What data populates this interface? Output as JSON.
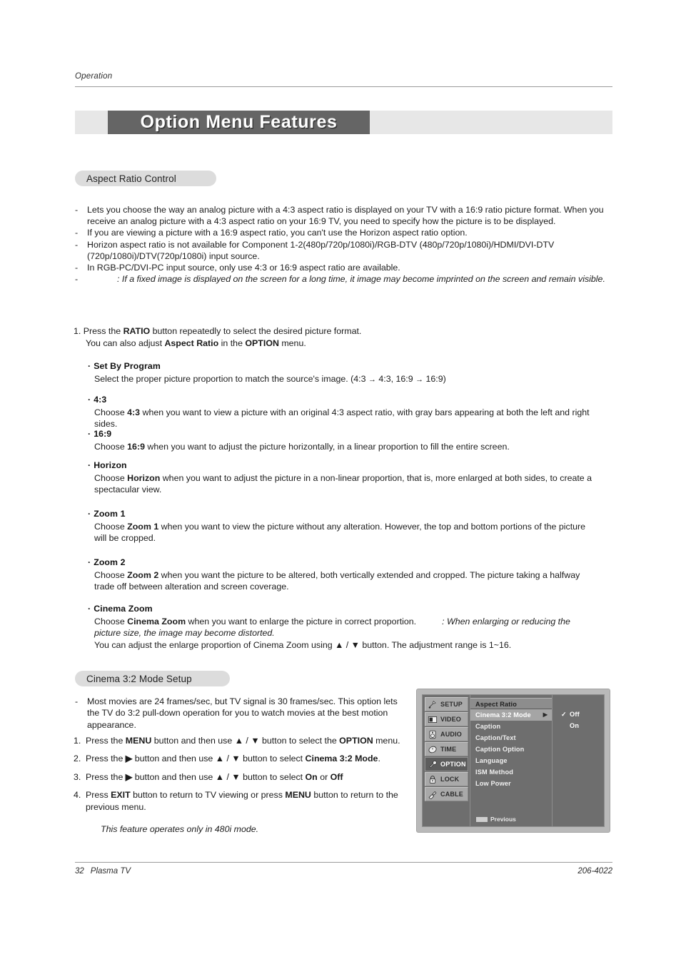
{
  "header": {
    "running_head": "Operation",
    "banner_title": "Option Menu Features"
  },
  "sections": {
    "aspect_pill": "Aspect Ratio Control",
    "cinema_pill": "Cinema 3:2 Mode Setup"
  },
  "aspect_bullets": [
    {
      "marker": "-",
      "text": "Lets you choose the way an analog picture with a 4:3 aspect ratio is displayed on your TV with a 16:9 ratio picture format. When you receive an analog picture with a 4:3 aspect ratio on your 16:9 TV, you need to specify how the picture is to be displayed."
    },
    {
      "marker": "-",
      "text": "If you are viewing a picture with a 16:9 aspect ratio, you can't use the Horizon aspect ratio option."
    },
    {
      "marker": "-",
      "text": "Horizon aspect ratio is not available for Component 1-2(480p/720p/1080i)/RGB-DTV (480p/720p/1080i)/HDMI/DVI-DTV (720p/1080i)/DTV(720p/1080i) input source."
    },
    {
      "marker": "-",
      "text": "In RGB-PC/DVI-PC input source, only use 4:3 or 16:9 aspect ratio are available."
    },
    {
      "marker": "-",
      "text": ": If a fixed image is displayed on the screen for a long time, it image may become imprinted on the screen and remain visible."
    }
  ],
  "step_one": {
    "line1_a": "1. Press the ",
    "line1_b": "RATIO",
    "line1_c": " button repeatedly to select the desired picture format.",
    "line2_a": "You can also adjust ",
    "line2_b": "Aspect Ratio",
    "line2_c": " in the ",
    "line2_d": "OPTION",
    "line2_e": " menu."
  },
  "options": [
    {
      "heading": "Set By Program",
      "body_pre": "Select the proper picture proportion to match the source's image.  (4:3 ",
      "body_arrow1": "→",
      "body_mid": " 4:3, 16:9 ",
      "body_arrow2": "→",
      "body_post": " 16:9)"
    },
    {
      "heading": "4:3",
      "body_pre": "Choose ",
      "body_bold": "4:3",
      "body_post": " when you want to view a picture with an original 4:3 aspect ratio, with gray bars appearing at both the left and right sides."
    },
    {
      "heading": "16:9",
      "body_pre": "Choose ",
      "body_bold": "16:9",
      "body_post": " when you want to adjust the picture horizontally, in a linear proportion to fill the entire screen."
    },
    {
      "heading": "Horizon",
      "body_pre": "Choose ",
      "body_bold": "Horizon",
      "body_post": " when you want to adjust the picture in a non-linear proportion, that is, more enlarged at both sides, to create a spectacular view."
    },
    {
      "heading": "Zoom 1",
      "body_pre": "Choose ",
      "body_bold": "Zoom 1",
      "body_post": " when you want to view the picture without any alteration. However, the top and bottom portions of the picture will be cropped."
    },
    {
      "heading": "Zoom 2",
      "body_pre": "Choose ",
      "body_bold": "Zoom 2",
      "body_post": " when you want the picture to be altered, both vertically extended and cropped. The picture taking a halfway trade off between alteration and screen coverage."
    },
    {
      "heading": "Cinema Zoom",
      "body_pre": "Choose ",
      "body_bold": "Cinema Zoom",
      "body_post": " when you want to enlarge the picture in correct proportion.",
      "body_italic": ": When enlarging or reducing the picture size, the image may become distorted.",
      "body_line3_a": "You can adjust the enlarge proportion of Cinema Zoom using ",
      "body_line3_up": "▲",
      "body_line3_sep": " / ",
      "body_line3_dn": "▼",
      "body_line3_b": " button. The adjustment range is 1~16."
    }
  ],
  "cinema32": {
    "intro_marker": "-",
    "intro": "Most movies are 24 frames/sec, but TV signal is 30 frames/sec. This option lets the TV do 3:2 pull-down operation for you to watch movies at the best motion appearance.",
    "steps": [
      {
        "num": "1.",
        "pre": "Press the ",
        "bold1": "MENU",
        "mid1": " button and then use ",
        "up": "▲",
        "sep": " / ",
        "down": "▼",
        "mid2": " button to select the ",
        "bold2": "OPTION",
        "post": " menu."
      },
      {
        "num": "2.",
        "pre": "Press the ",
        "bold1": "▶",
        "mid1": " button and then use ",
        "up": "▲",
        "sep": " / ",
        "down": "▼",
        "mid2": " button to select ",
        "bold2": "Cinema 3:2 Mode",
        "post": "."
      },
      {
        "num": "3.",
        "pre": "Press the ",
        "bold1": "▶",
        "mid1": " button and then use ",
        "up": "▲",
        "sep": " / ",
        "down": "▼",
        "mid2": " button to select ",
        "bold2": "On",
        "post": " or ",
        "bold3": "Off"
      },
      {
        "num": "4.",
        "pre": "Press ",
        "bold1": "EXIT",
        "mid1": " button to return to TV viewing or press ",
        "bold2": "MENU",
        "post": " button to return to the previous menu."
      }
    ],
    "note": "This feature operates only in 480i mode."
  },
  "osd": {
    "tabs": [
      {
        "label": "SETUP",
        "icon": "satellite-dish-icon",
        "selected": false
      },
      {
        "label": "VIDEO",
        "icon": "display-icon",
        "selected": false
      },
      {
        "label": "AUDIO",
        "icon": "speaker-icon",
        "selected": false
      },
      {
        "label": "TIME",
        "icon": "clock-icon",
        "selected": false
      },
      {
        "label": "OPTION",
        "icon": "wrench-icon",
        "selected": true
      },
      {
        "label": "LOCK",
        "icon": "padlock-icon",
        "selected": false
      },
      {
        "label": "CABLE",
        "icon": "cable-plug-icon",
        "selected": false
      }
    ],
    "items": [
      {
        "label": "Aspect Ratio",
        "state": "first",
        "arrow": ""
      },
      {
        "label": "Cinema 3:2 Mode",
        "state": "highlighted",
        "arrow": "▶"
      },
      {
        "label": "Caption",
        "state": "normal",
        "arrow": ""
      },
      {
        "label": "Caption/Text",
        "state": "normal",
        "arrow": ""
      },
      {
        "label": "Caption Option",
        "state": "normal",
        "arrow": ""
      },
      {
        "label": "Language",
        "state": "normal",
        "arrow": ""
      },
      {
        "label": "ISM Method",
        "state": "normal",
        "arrow": ""
      },
      {
        "label": "Low Power",
        "state": "normal",
        "arrow": ""
      }
    ],
    "values": [
      {
        "label": "Off",
        "checked": true,
        "check": "✓"
      },
      {
        "label": "On",
        "checked": false,
        "check": ""
      }
    ],
    "previous_label": "Previous"
  },
  "footer": {
    "page_number": "32",
    "product": "Plasma TV",
    "doc_code": "206-4022"
  },
  "colors": {
    "banner_dark": "#656565",
    "banner_band": "#e7e7e7",
    "pill_bg": "#dcdcdc",
    "osd_bg": "#6e6e6e",
    "osd_highlight": "#a5a5a5",
    "rule": "#9a9a9a"
  }
}
